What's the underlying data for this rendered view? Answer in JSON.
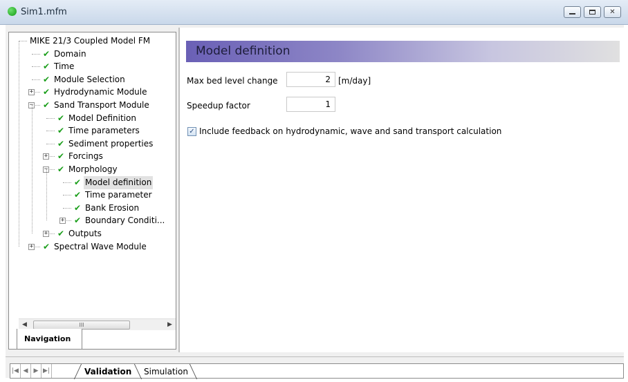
{
  "window": {
    "title": "Sim1.mfm",
    "minimize_label": "minimize",
    "maximize_label": "maximize",
    "close_label": "close",
    "status_color": "#139b13"
  },
  "navigation": {
    "tab_label": "Navigation",
    "scrollbar_grip": "III",
    "tree": [
      {
        "label": "MIKE 21/3 Coupled Model FM",
        "level": 0,
        "checked": false,
        "expander": "none"
      },
      {
        "label": "Domain",
        "level": 1,
        "checked": true,
        "expander": "none"
      },
      {
        "label": "Time",
        "level": 1,
        "checked": true,
        "expander": "none"
      },
      {
        "label": "Module Selection",
        "level": 1,
        "checked": true,
        "expander": "none"
      },
      {
        "label": "Hydrodynamic Module",
        "level": 1,
        "checked": true,
        "expander": "plus"
      },
      {
        "label": "Sand Transport Module",
        "level": 1,
        "checked": true,
        "expander": "minus"
      },
      {
        "label": "Model Definition",
        "level": 2,
        "checked": true,
        "expander": "none"
      },
      {
        "label": "Time parameters",
        "level": 2,
        "checked": true,
        "expander": "none"
      },
      {
        "label": "Sediment properties",
        "level": 2,
        "checked": true,
        "expander": "none"
      },
      {
        "label": "Forcings",
        "level": 2,
        "checked": true,
        "expander": "plus"
      },
      {
        "label": "Morphology",
        "level": 2,
        "checked": true,
        "expander": "minus"
      },
      {
        "label": "Model definition",
        "level": 3,
        "checked": true,
        "expander": "none",
        "selected": true
      },
      {
        "label": "Time parameter",
        "level": 3,
        "checked": true,
        "expander": "none"
      },
      {
        "label": "Bank Erosion",
        "level": 3,
        "checked": true,
        "expander": "none"
      },
      {
        "label": "Boundary Conditi...",
        "level": 3,
        "checked": true,
        "expander": "plus"
      },
      {
        "label": "Outputs",
        "level": 2,
        "checked": true,
        "expander": "plus"
      },
      {
        "label": "Spectral Wave Module",
        "level": 1,
        "checked": true,
        "expander": "plus"
      }
    ]
  },
  "main": {
    "section_title": "Model definition",
    "fields": {
      "max_bed_label": "Max bed level change",
      "max_bed_value": "2",
      "max_bed_unit": "[m/day]",
      "speedup_label": "Speedup factor",
      "speedup_value": "1"
    },
    "feedback": {
      "checked": true,
      "label": "Include feedback on hydrodynamic, wave and sand transport calculation"
    }
  },
  "bottom_tabs": {
    "tabs": [
      "Validation",
      "Simulation"
    ],
    "active": "Validation"
  },
  "colors": {
    "header_gradient_start": "#6a60b6",
    "check_green": "#1a9e1a"
  }
}
